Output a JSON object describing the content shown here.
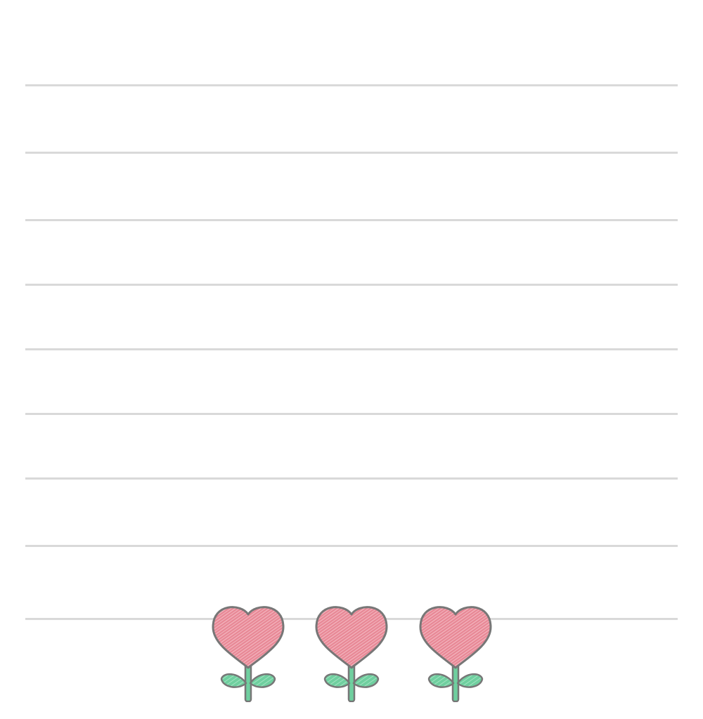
{
  "paper": {
    "background_color": "#ffffff",
    "rule_color": "#d9d9d9",
    "rule_count": 9
  },
  "decoration": {
    "icon": "heart-flower-icon",
    "count": 3,
    "petal_color": "#e88896",
    "hatch_color": "#f4b8c1",
    "leaf_color": "#6fcf9f",
    "outline_color": "#777777"
  }
}
